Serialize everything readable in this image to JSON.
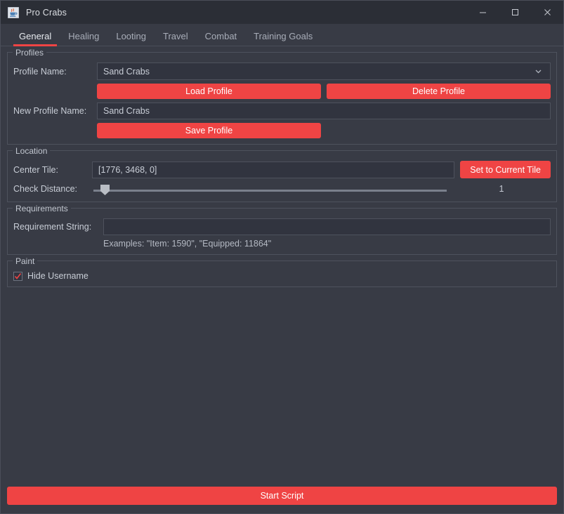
{
  "window": {
    "title": "Pro Crabs",
    "icon": "java-app-icon",
    "controls": {
      "minimize": "—",
      "maximize": "☐",
      "close": "✕"
    }
  },
  "colors": {
    "accent": "#ef4444",
    "background": "#383b45",
    "titlebar": "#2b2e36",
    "field": "#31343f",
    "border": "#4e525d",
    "text": "#c7ccd5"
  },
  "tabs": [
    {
      "label": "General",
      "active": true
    },
    {
      "label": "Healing",
      "active": false
    },
    {
      "label": "Looting",
      "active": false
    },
    {
      "label": "Travel",
      "active": false
    },
    {
      "label": "Combat",
      "active": false
    },
    {
      "label": "Training Goals",
      "active": false
    }
  ],
  "profiles": {
    "title": "Profiles",
    "profile_name_label": "Profile Name:",
    "profile_name_value": "Sand Crabs",
    "load_button": "Load Profile",
    "delete_button": "Delete Profile",
    "new_profile_label": "New Profile Name:",
    "new_profile_value": "Sand Crabs",
    "new_profile_placeholder": "Sand Crabs",
    "save_button": "Save Profile"
  },
  "location": {
    "title": "Location",
    "center_tile_label": "Center Tile:",
    "center_tile_value": "[1776, 3468, 0]",
    "set_tile_button": "Set to Current Tile",
    "check_distance_label": "Check Distance:",
    "check_distance_value": "1"
  },
  "requirements": {
    "title": "Requirements",
    "requirement_label": "Requirement String:",
    "requirement_value": "",
    "requirement_placeholder": "",
    "examples": "Examples: \"Item: 1590\", \"Equipped: 11864\""
  },
  "paint": {
    "title": "Paint",
    "hide_username_label": "Hide Username",
    "hide_username_checked": true
  },
  "footer": {
    "start_button": "Start Script"
  }
}
